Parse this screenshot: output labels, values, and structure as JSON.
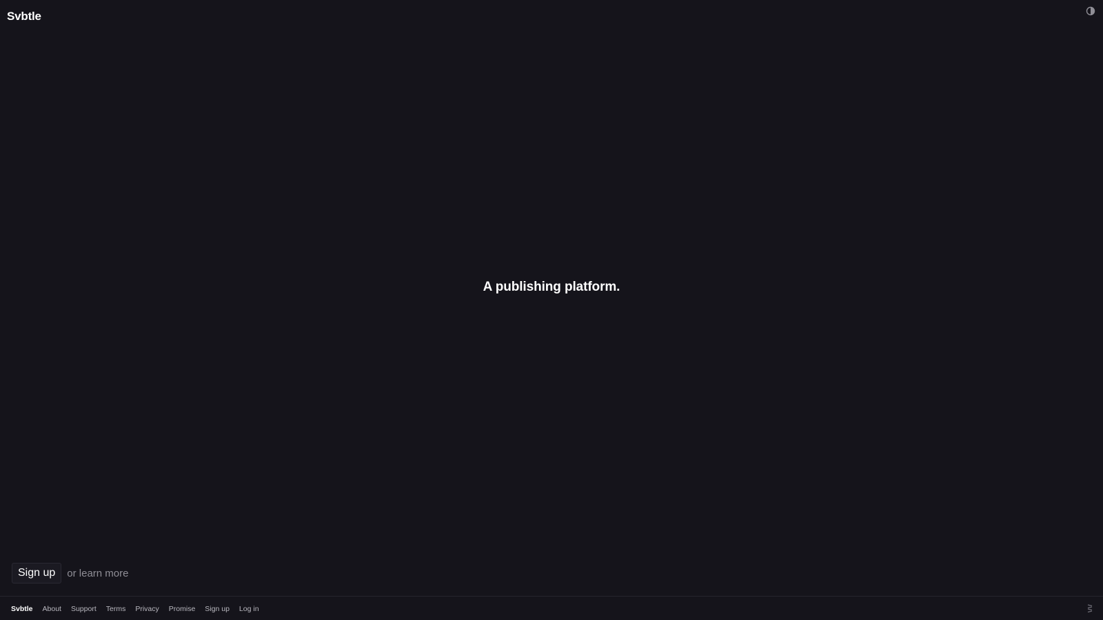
{
  "header": {
    "brand": "Svbtle",
    "theme_toggle_icon": "contrast-icon"
  },
  "hero": {
    "tagline": "A publishing platform."
  },
  "cta": {
    "signup_label": "Sign up",
    "learn_more_label": "or learn more"
  },
  "footer": {
    "brand": "Svbtle",
    "links": [
      "About",
      "Support",
      "Terms",
      "Privacy",
      "Promise",
      "Sign up",
      "Log in"
    ],
    "logo_icon": "svbtle-logo-icon"
  },
  "colors": {
    "background": "#15141b",
    "text": "#ffffff",
    "muted": "#8f8e96"
  }
}
